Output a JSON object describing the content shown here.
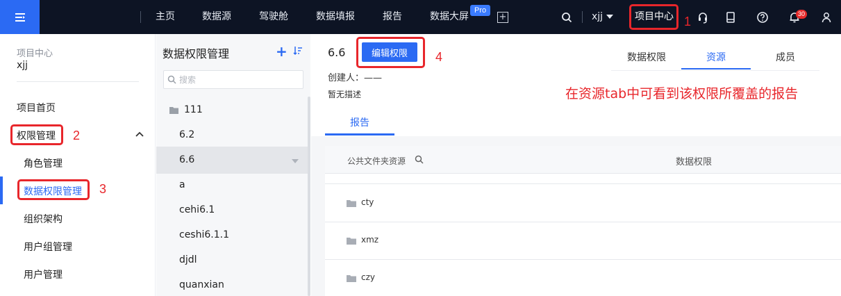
{
  "topbar": {
    "nav": [
      "主页",
      "数据源",
      "驾驶舱",
      "数据填报",
      "报告",
      "数据大屏"
    ],
    "pro_badge": "Pro",
    "user": "xjj",
    "project_center": "项目中心",
    "notification_count": "30",
    "icons": [
      "hamburger-menu-icon",
      "add-screen-icon",
      "search-icon",
      "headset-icon",
      "bookmark-icon",
      "help-icon",
      "bell-icon",
      "user-icon"
    ]
  },
  "sidebar": {
    "project_label": "项目中心",
    "project_name": "xjj",
    "items": {
      "home": "项目首页",
      "permission": "权限管理",
      "role": "角色管理",
      "data_permission": "数据权限管理",
      "org": "组织架构",
      "user_group": "用户组管理",
      "user": "用户管理"
    }
  },
  "tree": {
    "title": "数据权限管理",
    "search_placeholder": "搜索",
    "items": [
      "111",
      "6.2",
      "6.6",
      "a",
      "cehi6.1",
      "ceshi6.1.1",
      "djdl",
      "quanxian"
    ],
    "selected": "6.6"
  },
  "main": {
    "title": "6.6",
    "edit_button": "编辑权限",
    "creator": "创建人：——",
    "description": "暂无描述",
    "tabs": [
      "数据权限",
      "资源",
      "成员"
    ],
    "active_tab": "资源",
    "sub_tab": "报告",
    "table": {
      "col1": "公共文件夹资源",
      "col2": "数据权限",
      "rows": [
        "cty",
        "xmz",
        "czy"
      ]
    }
  },
  "annotations": {
    "n1": "1",
    "n2": "2",
    "n3": "3",
    "n4": "4",
    "note": "在资源tab中可看到该权限所覆盖的报告"
  },
  "colors": {
    "accent": "#2b6af3",
    "topbar": "#0d1424",
    "annotation": "#e8262b"
  }
}
